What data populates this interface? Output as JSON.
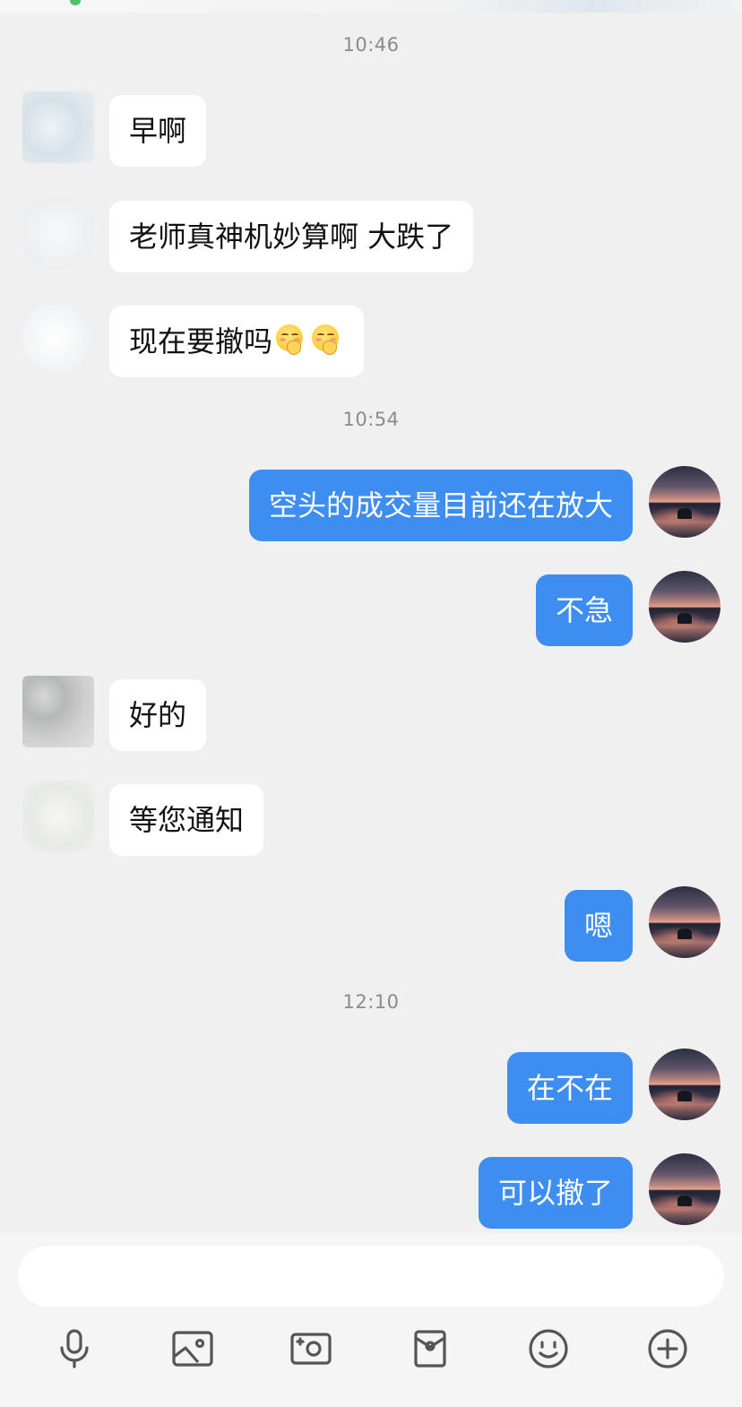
{
  "colors": {
    "background": "#f0f0f1",
    "incoming_bubble": "#ffffff",
    "outgoing_bubble": "#3d8ef0",
    "timestamp_text": "#8b8b8b",
    "icon": "#555555"
  },
  "chat": {
    "timestamps": [
      "10:46",
      "10:54",
      "12:10"
    ],
    "messages": [
      {
        "direction": "in",
        "text": "早啊"
      },
      {
        "direction": "in",
        "text": "老师真神机妙算啊 大跌了"
      },
      {
        "direction": "in",
        "text": "现在要撤吗",
        "emoji": [
          "praying-face-emoji",
          "praying-face-emoji"
        ]
      },
      {
        "direction": "out",
        "text": "空头的成交量目前还在放大"
      },
      {
        "direction": "out",
        "text": "不急"
      },
      {
        "direction": "in",
        "text": "好的"
      },
      {
        "direction": "in",
        "text": "等您通知"
      },
      {
        "direction": "out",
        "text": "嗯"
      },
      {
        "direction": "out",
        "text": "在不在"
      },
      {
        "direction": "out",
        "text": "可以撤了"
      }
    ]
  },
  "input": {
    "value": "",
    "placeholder": ""
  },
  "toolbar": {
    "icons": [
      "microphone-icon",
      "image-icon",
      "camera-icon",
      "red-packet-icon",
      "emoji-icon",
      "plus-icon"
    ]
  }
}
